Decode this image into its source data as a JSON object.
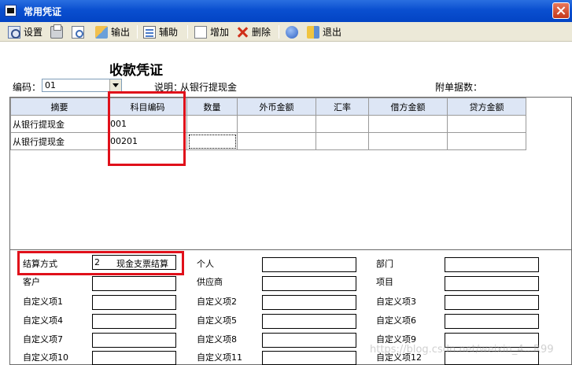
{
  "window": {
    "title": "常用凭证"
  },
  "toolbar": {
    "settings": "设置",
    "export": "输出",
    "assist": "辅助",
    "add": "增加",
    "delete": "删除",
    "exit": "退出"
  },
  "voucher": {
    "title": "收款凭证",
    "code_label": "编码：",
    "code_value": "01",
    "desc_label": "说明：",
    "desc_value": "从银行提现金",
    "attach_label": "附单据数："
  },
  "grid": {
    "columns": [
      "摘要",
      "科目编码",
      "数量",
      "外币金额",
      "汇率",
      "借方金额",
      "贷方金额"
    ],
    "rows": [
      [
        "从银行提现金",
        "001",
        "",
        "",
        "",
        "",
        ""
      ],
      [
        "从银行提现金",
        "00201",
        "",
        "",
        "",
        "",
        ""
      ]
    ]
  },
  "aux": {
    "settle_label": "结算方式",
    "settle_code": "2",
    "settle_name": "现金支票结算",
    "customer": "客户",
    "person": "个人",
    "supplier": "供应商",
    "dept": "部门",
    "project": "项目",
    "c1": "自定义项1",
    "c2": "自定义项2",
    "c3": "自定义项3",
    "c4": "自定义项4",
    "c5": "自定义项5",
    "c6": "自定义项6",
    "c7": "自定义项7",
    "c8": "自定义项8",
    "c9": "自定义项9",
    "c10": "自定义项10",
    "c11": "自定义项11",
    "c12": "自定义项12"
  },
  "watermark": "https://blog.csdn.net/weixin_4...R99",
  "colors": {
    "titlebar": "#0a4fd0",
    "highlight": "#e0101a",
    "grid_header": "#dde6f5"
  }
}
